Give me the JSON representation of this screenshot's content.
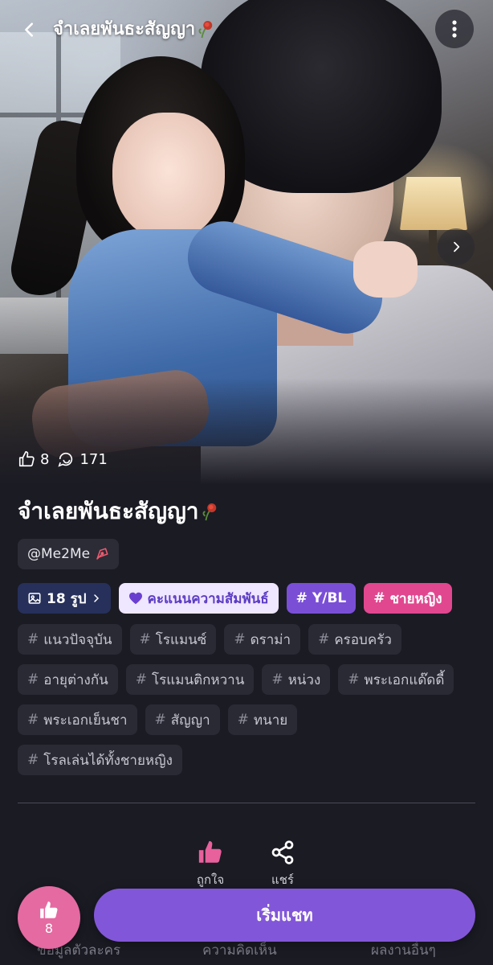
{
  "header": {
    "title": "จำเลยพันธะสัญญา",
    "back_icon": "chevron-left-icon",
    "more_icon": "more-vertical-icon"
  },
  "hero": {
    "next_icon": "chevron-right-icon"
  },
  "stats": {
    "likes": "8",
    "comments": "171"
  },
  "character": {
    "name": "จำเลยพันธะสัญญา",
    "creator": "@Me2Me"
  },
  "badges": {
    "gallery": "18 รูป",
    "affinity": "คะแนนความสัมพันธ์",
    "genre": "Y/BL",
    "gender": "ชายหญิง"
  },
  "tags": [
    "แนวปัจจุบัน",
    "โรแมนซ์",
    "ดราม่า",
    "ครอบครัว",
    "อายุต่างกัน",
    "โรแมนติกหวาน",
    "หน่วง",
    "พระเอกแด๊ดดี้",
    "พระเอกเย็นชา",
    "สัญญา",
    "ทนาย",
    "โรลเล่นได้ทั้งชายหญิง"
  ],
  "actions": {
    "like_label": "ถูกใจ",
    "share_label": "แชร์"
  },
  "bottom_tabs": {
    "tab1": "ข้อมูลตัวละคร",
    "tab2": "ความคิดเห็น",
    "tab3": "ผลงานอื่นๆ"
  },
  "footer": {
    "like_count": "8",
    "start_chat": "เริ่มแชท"
  },
  "colors": {
    "background": "#1b1b24",
    "accent_purple": "#8256d8",
    "accent_pink": "#e1478f",
    "like_fab": "#e56aa1"
  }
}
